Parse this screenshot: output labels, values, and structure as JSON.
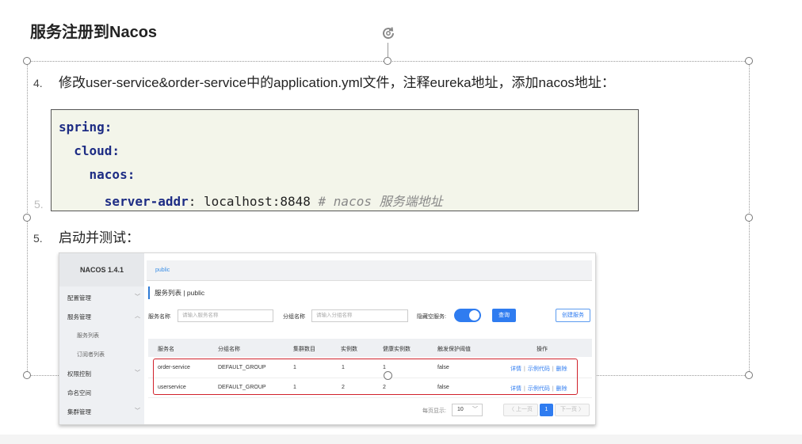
{
  "slide": {
    "title": "服务注册到Nacos",
    "step4": {
      "num": "4.",
      "text": "修改user-service&order-service中的application.yml文件，注释eureka地址，添加nacos地址："
    },
    "ghost_num": "5.",
    "step5": {
      "num": "5.",
      "text": "启动并测试："
    }
  },
  "code": {
    "line1_key": "spring:",
    "line2_key": "cloud:",
    "line3_key": "nacos:",
    "line4_key": "server-addr",
    "line4_colon": ": ",
    "line4_value": "localhost:8848 ",
    "line4_comment": "# nacos 服务端地址"
  },
  "nacos": {
    "brand": "NACOS 1.4.1",
    "menu": {
      "config": "配置管理",
      "service": "服务管理",
      "service_list": "服务列表",
      "subscribers": "订阅者列表",
      "auth": "权限控制",
      "namespace": "命名空间",
      "cluster": "集群管理"
    },
    "tab": "public",
    "header": "服务列表 | public",
    "filters": {
      "service_name_label": "服务名称",
      "service_name_placeholder": "请输入服务名称",
      "group_name_label": "分组名称",
      "group_name_placeholder": "请输入分组名称",
      "hide_empty_label": "隐藏空服务:",
      "query_button": "查询",
      "create_button": "创建服务"
    },
    "table": {
      "columns": [
        "服务名",
        "分组名称",
        "集群数目",
        "实例数",
        "健康实例数",
        "触发保护阈值",
        "操作"
      ],
      "rows": [
        {
          "name": "order-service",
          "group": "DEFAULT_GROUP",
          "clusters": "1",
          "instances": "1",
          "healthy": "1",
          "threshold": "false"
        },
        {
          "name": "userservice",
          "group": "DEFAULT_GROUP",
          "clusters": "1",
          "instances": "2",
          "healthy": "2",
          "threshold": "false"
        }
      ],
      "ops": {
        "detail": "详情",
        "sample": "示例代码",
        "delete": "删除",
        "sep": "|"
      }
    },
    "pager": {
      "per_page_label": "每页显示:",
      "per_page_value": "10",
      "prev": "〈 上一页",
      "page": "1",
      "next": "下一页 〉"
    }
  },
  "icons": {
    "rotate": "rotate-handle-icon",
    "chevron_down": "chevron-down-icon",
    "chevron_up": "chevron-up-icon"
  },
  "colors": {
    "code_keyword": "#1d2c84",
    "code_background": "#f3f5ea",
    "nacos_primary": "#2f7cf0",
    "highlight_box": "#d0212b"
  }
}
